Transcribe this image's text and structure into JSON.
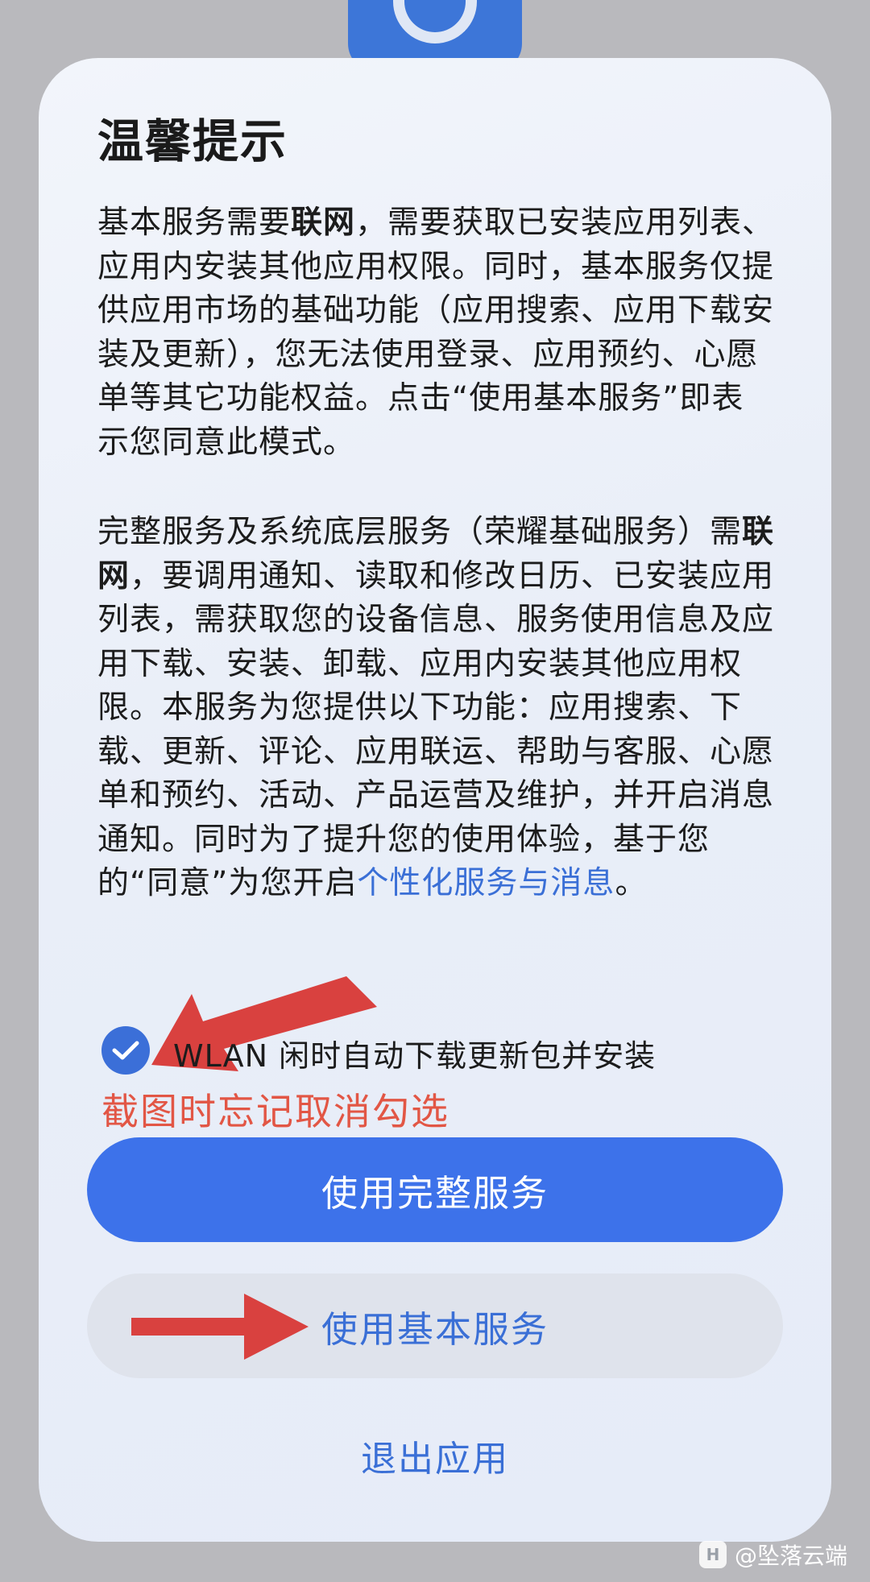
{
  "dialog": {
    "title": "温馨提示",
    "basic_paragraph": {
      "part1": "基本服务需要",
      "bold": "联网",
      "part2": "，需要获取已安装应用列表、应用内安装其他应用权限。同时，基本服务仅提供应用市场的基础功能（应用搜索、应用下载安装及更新），您无法使用登录、应用预约、心愿单等其它功能权益。点击“使用基本服务”即表示您同意此模式。"
    },
    "full_paragraph": {
      "part1": "完整服务及系统底层服务（荣耀基础服务）需",
      "bold": "联网",
      "part2": "，要调用通知、读取和修改日历、已安装应用列表，需获取您的设备信息、服务使用信息及应用下载、安装、卸载、应用内安装其他应用权限。本服务为您提供以下功能：应用搜索、下载、更新、评论、应用联运、帮助与客服、心愿单和预约、活动、产品运营及维护，并开启消息通知。同时为了提升您的使用体验，基于您的“同意”为您开启",
      "link": "个性化服务与消息",
      "end": "。"
    },
    "checkbox": {
      "label": "WLAN 闲时自动下载更新包并安装",
      "checked": true
    },
    "annotation_text": "截图时忘记取消勾选",
    "buttons": {
      "full_service": "使用完整服务",
      "basic_service": "使用基本服务",
      "exit": "退出应用"
    }
  },
  "watermark": {
    "icon_letter": "H",
    "text": "@坠落云端"
  },
  "colors": {
    "accent_blue": "#3d72ea",
    "link_blue": "#3a6fd6",
    "annotation_red": "#e25645",
    "arrow_red": "#d9413f"
  }
}
